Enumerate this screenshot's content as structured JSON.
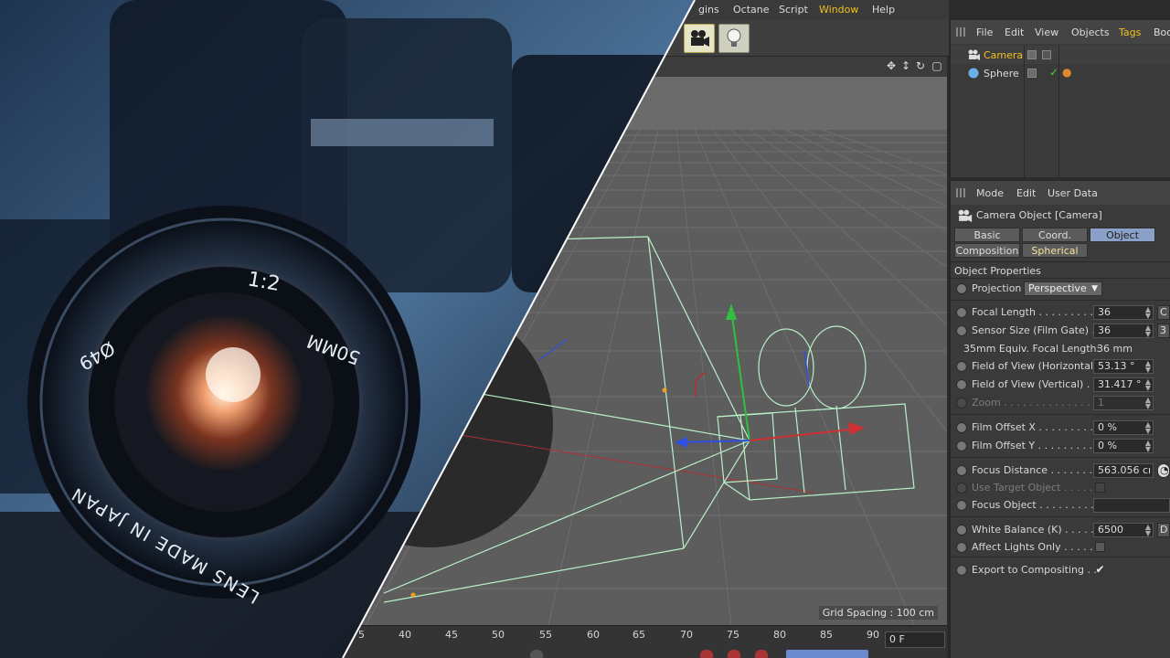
{
  "menubar": {
    "items": [
      {
        "label": "gins",
        "highlight": false
      },
      {
        "label": "Octane",
        "highlight": false
      },
      {
        "label": "Script",
        "highlight": false
      },
      {
        "label": "Window",
        "highlight": true
      },
      {
        "label": "Help",
        "highlight": false
      }
    ]
  },
  "toolbar": {
    "buttons": [
      {
        "name": "camera-tool-button",
        "icon": "movie-camera-icon",
        "active": true
      },
      {
        "name": "light-tool-button",
        "icon": "light-bulb-icon",
        "active": false
      }
    ]
  },
  "viewport": {
    "grid_spacing": "Grid Spacing : 100 cm",
    "nav_icons": [
      "move-view-icon",
      "zoom-view-icon",
      "rotate-view-icon",
      "maximize-view-icon"
    ]
  },
  "timeline": {
    "ticks": [
      "5",
      "40",
      "45",
      "50",
      "55",
      "60",
      "65",
      "70",
      "75",
      "80",
      "85",
      "90"
    ],
    "current_frame": "0 F"
  },
  "object_manager": {
    "menu": [
      {
        "label": "File",
        "highlight": false
      },
      {
        "label": "Edit",
        "highlight": false
      },
      {
        "label": "View",
        "highlight": false
      },
      {
        "label": "Objects",
        "highlight": false
      },
      {
        "label": "Tags",
        "highlight": true
      },
      {
        "label": "Boo",
        "highlight": false
      }
    ],
    "objects": [
      {
        "name": "Camera",
        "selected": true,
        "icon": "camera-object-icon"
      },
      {
        "name": "Sphere",
        "selected": false,
        "icon": "sphere-object-icon"
      }
    ]
  },
  "attribute_manager": {
    "menu": [
      "Mode",
      "Edit",
      "User Data"
    ],
    "title": "Camera Object [Camera]",
    "tabs": [
      {
        "label": "Basic",
        "active": false,
        "yellow": false
      },
      {
        "label": "Coord.",
        "active": false,
        "yellow": false
      },
      {
        "label": "Object",
        "active": true,
        "yellow": false
      },
      {
        "label": "Composition",
        "active": false,
        "yellow": false
      },
      {
        "label": "Spherical",
        "active": false,
        "yellow": true
      }
    ],
    "section": "Object Properties",
    "projection": {
      "label": "Projection",
      "value": "Perspective"
    },
    "properties": [
      {
        "label": "Focal Length . . . . . . . . . . .",
        "value": "36",
        "extra": "C",
        "dim": false,
        "type": "input"
      },
      {
        "label": "Sensor Size (Film Gate) . .",
        "value": "36",
        "extra": "3",
        "dim": false,
        "type": "input"
      },
      {
        "label": "35mm Equiv. Focal Length:",
        "value": "36 mm",
        "dim": false,
        "type": "static"
      },
      {
        "label": "Field of View (Horizontal)",
        "value": "53.13 °",
        "dim": false,
        "type": "input"
      },
      {
        "label": "Field of View (Vertical) . .",
        "value": "31.417 °",
        "dim": false,
        "type": "input"
      },
      {
        "label": "Zoom . . . . . . . . . . . . . . . . .",
        "value": "1",
        "dim": true,
        "type": "input"
      },
      {
        "label": "Film Offset X . . . . . . . . . .",
        "value": "0 %",
        "dim": false,
        "type": "input"
      },
      {
        "label": "Film Offset Y . . . . . . . . . .",
        "value": "0 %",
        "dim": false,
        "type": "input"
      },
      {
        "label": "Focus Distance . . . . . . . . .",
        "value": "563.056 cı",
        "dim": false,
        "type": "input"
      },
      {
        "label": "Use Target Object . . . . . . .",
        "value": "",
        "dim": true,
        "type": "check"
      },
      {
        "label": "Focus Object . . . . . . . . . .",
        "value": "",
        "dim": false,
        "type": "input"
      },
      {
        "label": "White Balance (K) . . . . . .",
        "value": "6500",
        "extra": "D",
        "dim": false,
        "type": "input"
      },
      {
        "label": "Affect Lights Only . . . . . .",
        "value": "",
        "dim": false,
        "type": "check"
      },
      {
        "label": "Export to Compositing . .",
        "value": "✔",
        "dim": false,
        "type": "check"
      }
    ]
  },
  "photo": {
    "lens_text_1": "1:2",
    "lens_text_2": "50MM",
    "lens_text_3": "Ø49",
    "lens_text_4": "LENS MADE IN JAPAN"
  }
}
